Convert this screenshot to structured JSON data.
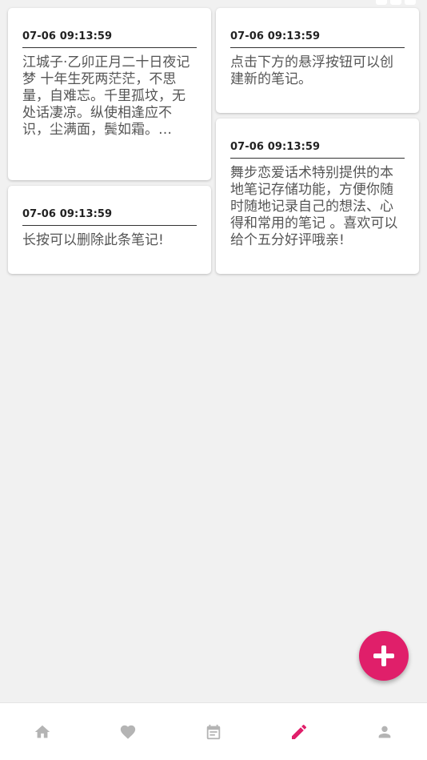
{
  "colors": {
    "accent": "#e01f6a",
    "nav_inactive": "#b4b4b4",
    "background": "#f1f1f1"
  },
  "notes": [
    {
      "date": "07-06 09:13:59",
      "text": "江城子·乙卯正月二十日夜记梦 十年生死两茫茫，不思量，自难忘。千里孤坟，无处话凄凉。纵使相逢应不识，尘满面，鬓如霜。\n夜来幽梦忽还乡，小轩窗…"
    },
    {
      "date": "07-06 09:13:59",
      "text": "点击下方的悬浮按钮可以创建新的笔记。"
    },
    {
      "date": "07-06 09:13:59",
      "text": "长按可以删除此条笔记!"
    },
    {
      "date": "07-06 09:13:59",
      "text": "舞步恋爱话术特别提供的本地笔记存储功能，方便你随时随地记录自己的想法、心得和常用的笔记 。喜欢可以给个五分好评哦亲!"
    }
  ],
  "fab": {
    "icon": "plus-icon"
  },
  "bottom_nav": {
    "active_index": 3,
    "items": [
      {
        "icon": "home-icon"
      },
      {
        "icon": "heart-icon"
      },
      {
        "icon": "calendar-note-icon"
      },
      {
        "icon": "pencil-icon"
      },
      {
        "icon": "person-icon"
      }
    ]
  }
}
